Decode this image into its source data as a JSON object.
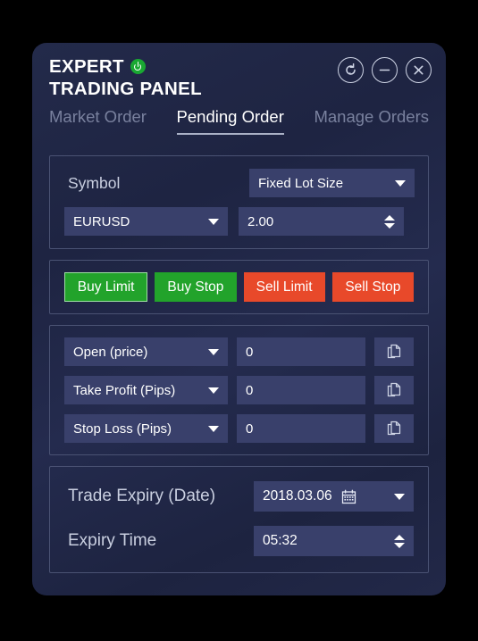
{
  "app": {
    "title_line1": "EXPERT",
    "title_line2": "TRADING PANEL",
    "power_icon": "power-icon"
  },
  "window_controls": [
    {
      "name": "refresh-button",
      "icon": "refresh-circle-icon"
    },
    {
      "name": "minimize-button",
      "icon": "minus-circle-icon"
    },
    {
      "name": "close-button",
      "icon": "close-circle-icon"
    }
  ],
  "tabs": [
    {
      "label": "Market Order",
      "active": false
    },
    {
      "label": "Pending Order",
      "active": true
    },
    {
      "label": "Manage Orders",
      "active": false
    }
  ],
  "symbol_section": {
    "label": "Symbol",
    "lot_mode": "Fixed Lot Size",
    "symbol_value": "EURUSD",
    "lot_value": "2.00"
  },
  "order_buttons": [
    {
      "label": "Buy Limit",
      "kind": "buy",
      "selected": true
    },
    {
      "label": "Buy Stop",
      "kind": "buy",
      "selected": false
    },
    {
      "label": "Sell Limit",
      "kind": "sell",
      "selected": false
    },
    {
      "label": "Sell Stop",
      "kind": "sell",
      "selected": false
    }
  ],
  "price_rows": [
    {
      "selector": "Open (price)",
      "value": "0",
      "copy_icon": "copy-icon"
    },
    {
      "selector": "Take Profit (Pips)",
      "value": "0",
      "copy_icon": "copy-icon"
    },
    {
      "selector": "Stop Loss (Pips)",
      "value": "0",
      "copy_icon": "copy-icon"
    }
  ],
  "expiry_section": {
    "date_label": "Trade Expiry (Date)",
    "date_value": "2018.03.06",
    "calendar_icon": "calendar-icon",
    "time_label": "Expiry Time",
    "time_value": "05:32"
  },
  "colors": {
    "page_background": "#000000",
    "panel_background": "#222848",
    "field_background": "#39406b",
    "section_border": "#4a5273",
    "buy_green": "#22a32b",
    "sell_red": "#e8492a",
    "power_green": "#19a832",
    "text_primary": "#ffffff",
    "text_muted": "#79819e",
    "label_text": "#c9cfe0"
  }
}
